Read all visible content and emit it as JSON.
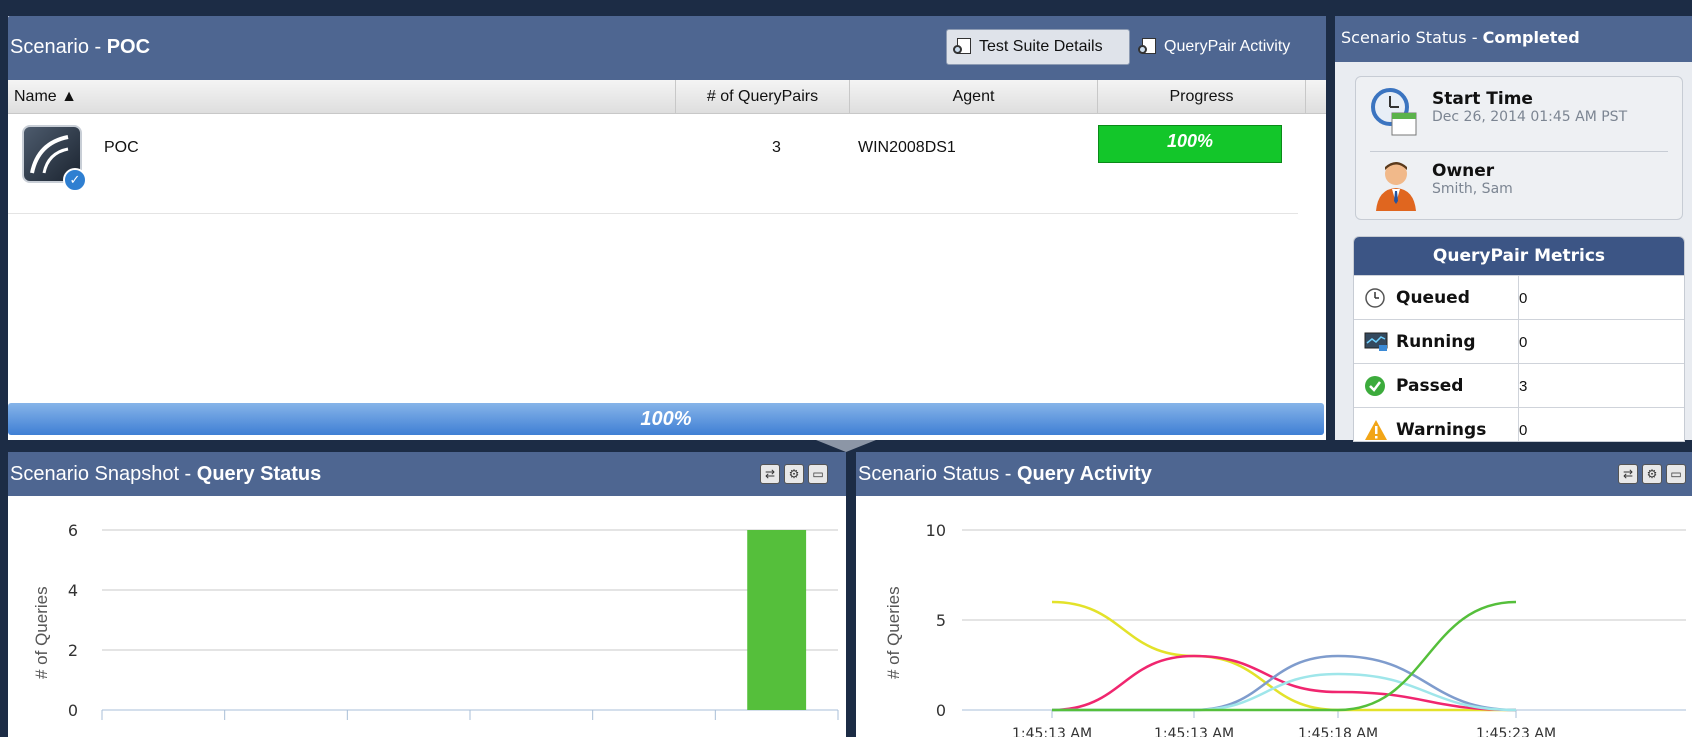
{
  "scenario": {
    "title_prefix": "Scenario - ",
    "title_name": "POC",
    "buttons": {
      "suite_details": "Test Suite Details",
      "querypair_activity": "QueryPair Activity"
    },
    "columns": {
      "name": "Name ▲",
      "querypairs": "# of QueryPairs",
      "agent": "Agent",
      "progress": "Progress"
    },
    "rows": [
      {
        "name": "POC",
        "querypairs": "3",
        "agent": "WIN2008DS1",
        "progress": "100%"
      }
    ],
    "overall_progress": "100%"
  },
  "status": {
    "title_prefix": "Scenario Status - ",
    "title_state": "Completed",
    "start_time_label": "Start Time",
    "start_time_value": "Dec 26, 2014 01:45 AM PST",
    "owner_label": "Owner",
    "owner_value": "Smith, Sam",
    "metrics_title": "QueryPair Metrics",
    "metrics": [
      {
        "label": "Queued",
        "value": "0",
        "icon": "clock-icon"
      },
      {
        "label": "Running",
        "value": "0",
        "icon": "monitor-icon"
      },
      {
        "label": "Passed",
        "value": "3",
        "icon": "check-circle-icon"
      },
      {
        "label": "Warnings",
        "value": "0",
        "icon": "warning-icon"
      }
    ]
  },
  "snapshot": {
    "title_prefix": "Scenario Snapshot - ",
    "title_bold": "Query Status"
  },
  "activity": {
    "title_prefix": "Scenario Status - ",
    "title_bold": "Query Activity"
  },
  "chart_data": [
    {
      "type": "bar",
      "ylabel": "# of Queries",
      "ylim": [
        0,
        6
      ],
      "yticks": [
        0,
        2,
        4,
        6
      ],
      "category_count": 6,
      "values": [
        0,
        0,
        0,
        0,
        0,
        6
      ],
      "bar_color": "#55bf3b",
      "grid": true
    },
    {
      "type": "line",
      "ylabel": "# of Queries",
      "ylim": [
        0,
        10
      ],
      "yticks": [
        0,
        5,
        10
      ],
      "x": [
        "1:45:13 AM",
        "1:45:13 AM",
        "1:45:18 AM",
        "1:45:23 AM"
      ],
      "series": [
        {
          "color": "#e3e22a",
          "values": [
            6,
            3,
            0,
            0
          ]
        },
        {
          "color": "#f0266f",
          "values": [
            0,
            3,
            1,
            0
          ]
        },
        {
          "color": "#7f9ccd",
          "values": [
            0,
            0,
            3,
            0
          ]
        },
        {
          "color": "#9fe6ea",
          "values": [
            0,
            0,
            2,
            0
          ]
        },
        {
          "color": "#55bf3b",
          "values": [
            0,
            0,
            0,
            6
          ]
        }
      ],
      "grid": true
    }
  ]
}
